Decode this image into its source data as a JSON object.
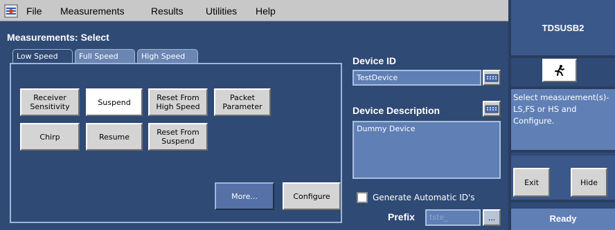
{
  "menu": {
    "file": "File",
    "measurements": "Measurements",
    "results": "Results",
    "utilities": "Utilities",
    "help": "Help"
  },
  "panel": {
    "title": "Measurements: Select",
    "tabs": [
      "Low Speed",
      "Full Speed",
      "High Speed"
    ],
    "active_tab": "Low Speed",
    "measurement_buttons": {
      "receiver_sensitivity": "Receiver Sensitivity",
      "suspend": "Suspend",
      "reset_from_high_speed": "Reset From High Speed",
      "packet_parameter": "Packet Parameter",
      "chirp": "Chirp",
      "resume": "Resume",
      "reset_from_suspend": "Reset From Suspend"
    },
    "more_button": "More...",
    "configure_button": "Configure"
  },
  "device": {
    "id_label": "Device ID",
    "id_value": "TestDevice",
    "description_label": "Device Description",
    "description_value": "Dummy Device",
    "generate_ids_label": "Generate Automatic ID's",
    "generate_ids_checked": false,
    "prefix_label": "Prefix",
    "prefix_value": "tste_",
    "browse_button": "..."
  },
  "side": {
    "title": "TDSUSB2",
    "info_text": "Select measurement(s)- LS,FS or HS and Configure.",
    "exit_button": "Exit",
    "hide_button": "Hide",
    "status": "Ready"
  },
  "icons": {
    "app": "app-logo-icon",
    "run": "running-man-icon",
    "keyboard": "keyboard-icon"
  },
  "colors": {
    "background": "#2f4a74",
    "field": "#5f7fb5",
    "button": "#d4d4d4",
    "menubar": "#c8c8c8"
  }
}
